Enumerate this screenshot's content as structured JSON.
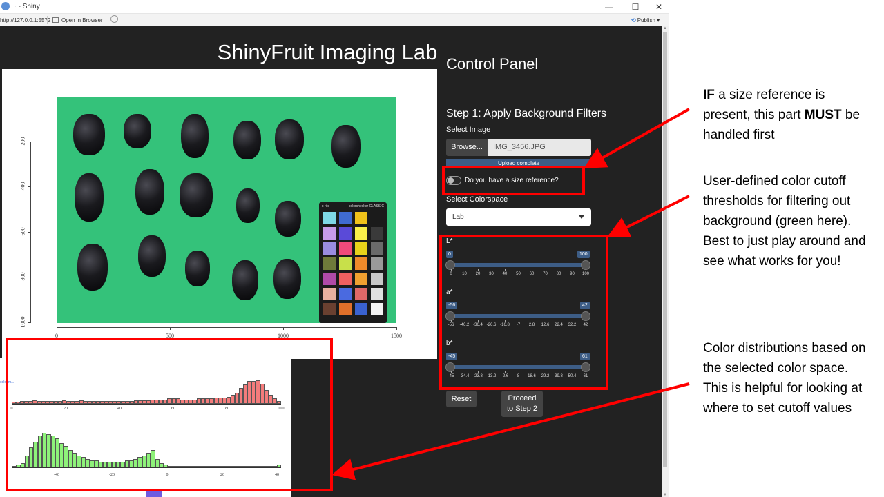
{
  "window": {
    "title": "~ - Shiny",
    "url": "http://127.0.0.1:5572",
    "open_in_browser": "Open in Browser",
    "publish": "Publish",
    "minimize": "—",
    "maximize": "☐",
    "close": "✕"
  },
  "app": {
    "title": "ShinyFruit Imaging Lab"
  },
  "image_plot": {
    "y_ticks": [
      "200",
      "400",
      "600",
      "800",
      "1000"
    ],
    "x_ticks": [
      "0",
      "500",
      "1000",
      "1500"
    ],
    "checker_brand": "x-rite",
    "checker_name": "colorchecker CLASSIC"
  },
  "histograms": {
    "tag": "colorim...",
    "L_ticks": [
      "0",
      "20",
      "40",
      "60",
      "80",
      "100"
    ],
    "a_ticks": [
      "-40",
      "-20",
      "0",
      "20",
      "40"
    ]
  },
  "control_panel": {
    "title": "Control Panel",
    "step_title": "Step 1: Apply Background Filters",
    "select_image_label": "Select Image",
    "browse_label": "Browse...",
    "file_name": "IMG_3456.JPG",
    "upload_status": "Upload complete",
    "size_ref_label": "Do you have a size reference?",
    "size_ref_on": false,
    "colorspace_label": "Select Colorspace",
    "colorspace_value": "Lab",
    "sliders": [
      {
        "label": "L*",
        "min_val": "0",
        "max_val": "100",
        "ticks": [
          "0",
          "10",
          "20",
          "30",
          "40",
          "50",
          "60",
          "70",
          "80",
          "90",
          "100"
        ]
      },
      {
        "label": "a*",
        "min_val": "-56",
        "max_val": "42",
        "ticks": [
          "-56",
          "-46.2",
          "-36.4",
          "-26.6",
          "-16.8",
          "-7",
          "2.8",
          "12.6",
          "22.4",
          "32.2",
          "42"
        ]
      },
      {
        "label": "b*",
        "min_val": "-45",
        "max_val": "61",
        "ticks": [
          "-45",
          "-34.4",
          "-23.8",
          "-13.2",
          "-2.6",
          "8",
          "18.6",
          "29.2",
          "39.8",
          "50.4",
          "61"
        ]
      }
    ],
    "reset_label": "Reset",
    "proceed_line1": "Proceed",
    "proceed_line2": "to Step 2"
  },
  "annotations": {
    "note1_bold1": "IF",
    "note1_a": " a size reference is present, this part ",
    "note1_bold2": "MUST",
    "note1_b": " be handled first",
    "note2": "User-defined color cutoff thresholds for filtering out background (green here).  Best to just play around and see what works for you!",
    "note3": "Color distributions based on the selected color space.  This is helpful for looking at where to set cutoff values"
  },
  "colors": {
    "app_bg": "#222222",
    "slider_blue": "#3d5d86",
    "annotation_red": "#ff0000",
    "photo_green": "#34c27a",
    "hist_L": "#f47c7c",
    "hist_a": "#8ef27a"
  }
}
